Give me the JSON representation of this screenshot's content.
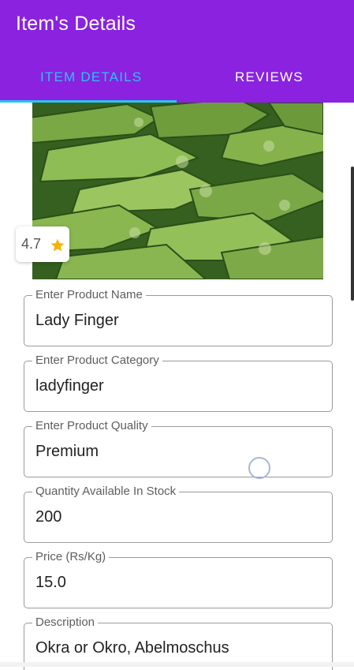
{
  "header": {
    "title": "Item's Details",
    "tabs": [
      {
        "label": "ITEM DETAILS",
        "active": true
      },
      {
        "label": "REVIEWS",
        "active": false
      }
    ]
  },
  "rating": {
    "value": "4.7",
    "icon": "star-icon"
  },
  "fields": [
    {
      "label": "Enter Product Name",
      "value": "Lady Finger"
    },
    {
      "label": "Enter Product Category",
      "value": "ladyfinger"
    },
    {
      "label": "Enter Product Quality",
      "value": "Premium"
    },
    {
      "label": "Quantity Available In Stock",
      "value": "200"
    },
    {
      "label": "Price (Rs/Kg)",
      "value": "15.0"
    },
    {
      "label": "Description",
      "value": "Okra or Okro, Abelmoschus"
    }
  ],
  "colors": {
    "appbar": "#8a22e0",
    "tab_active": "#27c6f2",
    "star": "#f5b301"
  }
}
